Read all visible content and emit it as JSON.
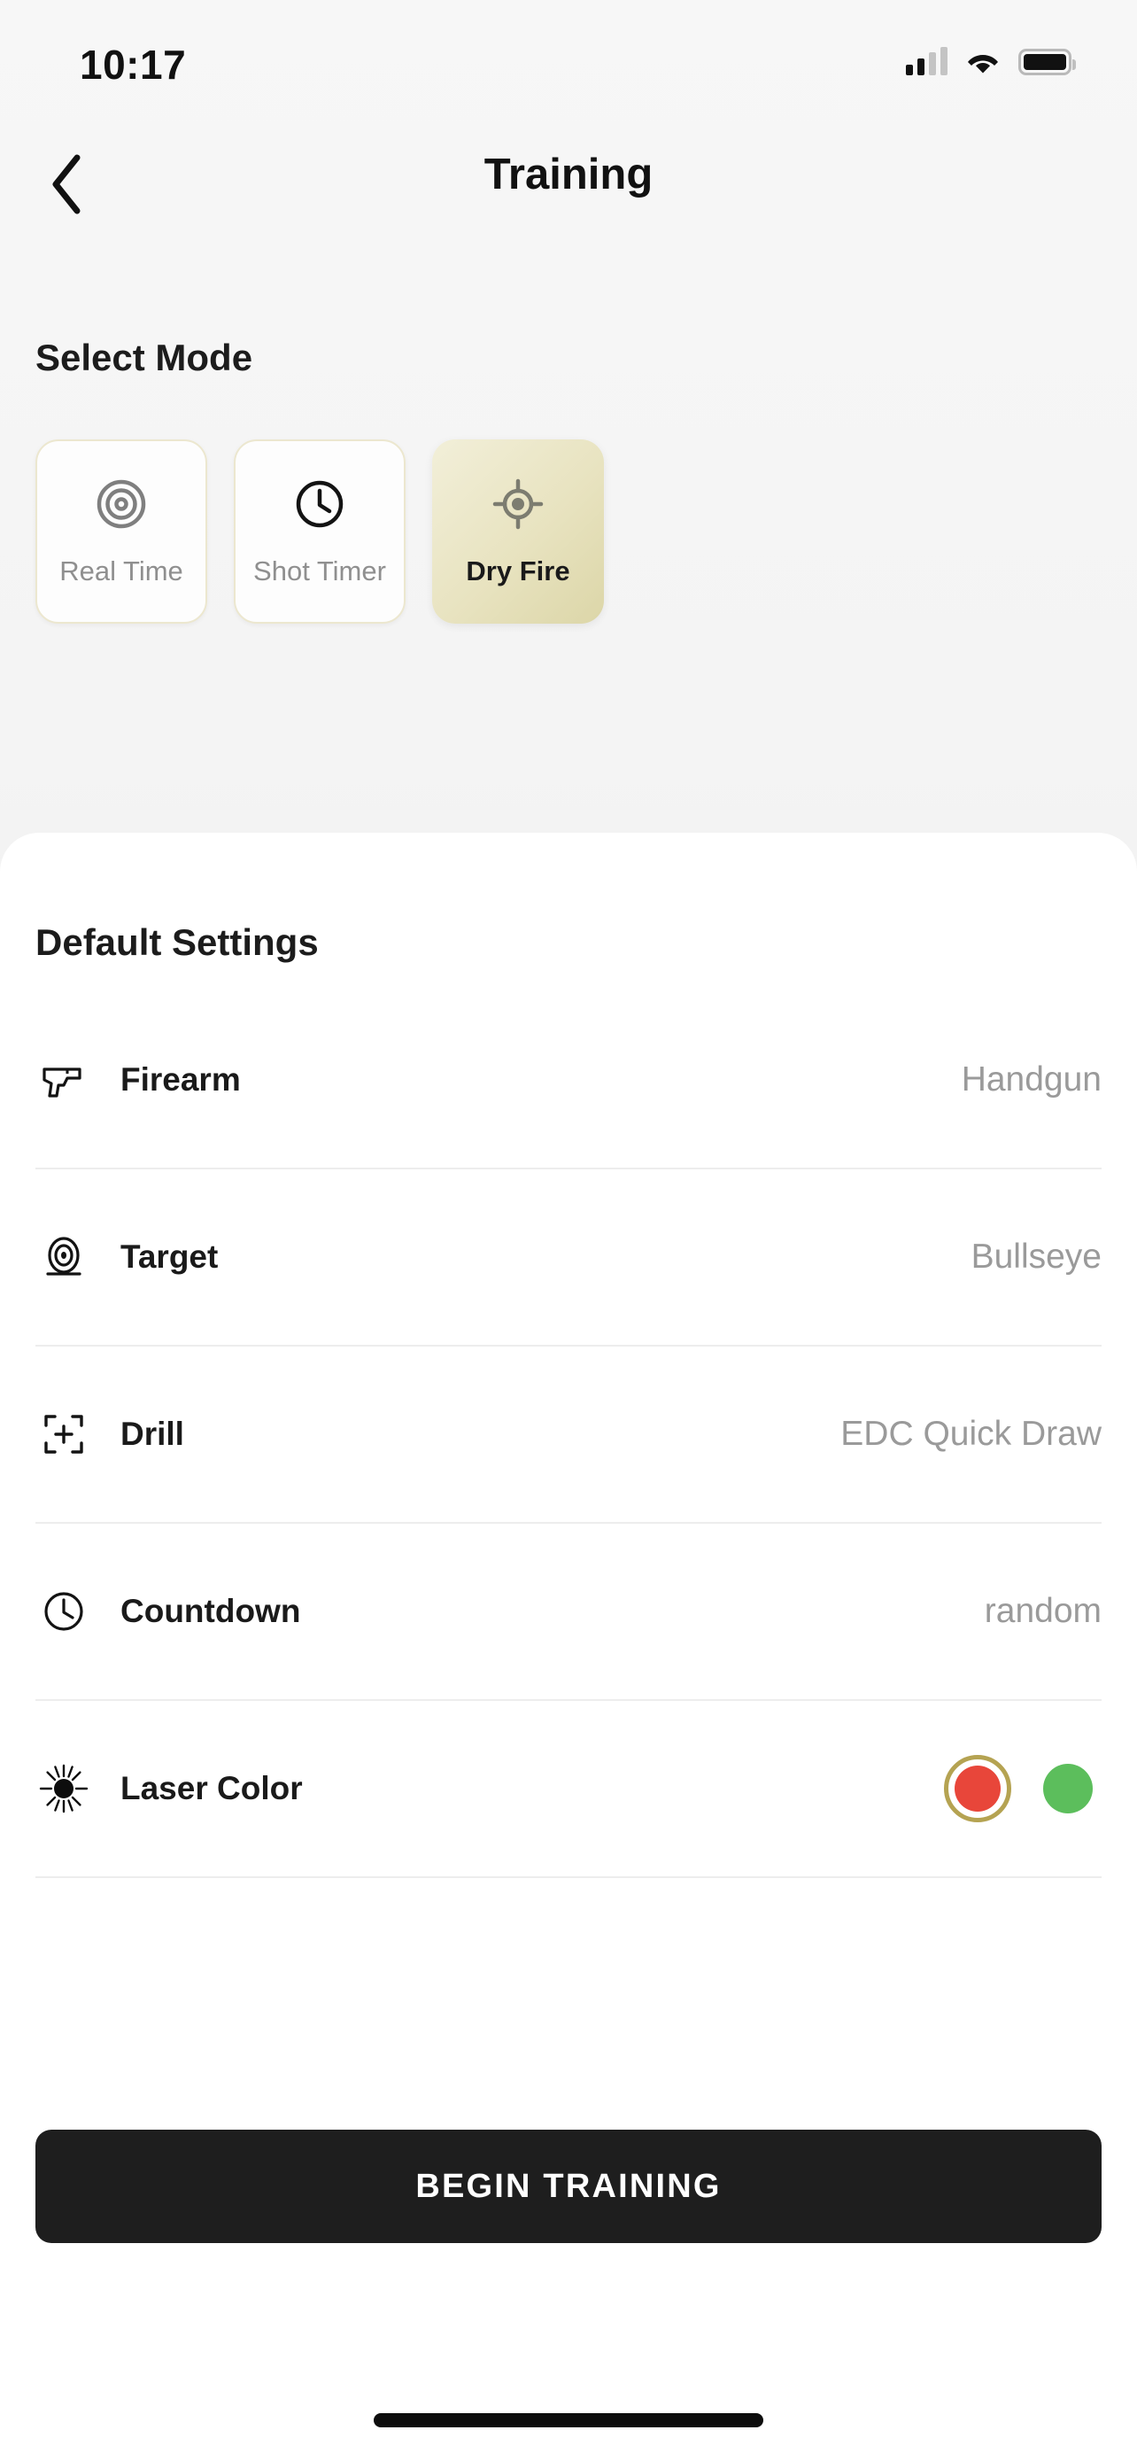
{
  "status_bar": {
    "time": "10:17",
    "cellular_icon": "signal-bars-icon",
    "wifi_icon": "wifi-icon",
    "battery_icon": "battery-full-icon"
  },
  "nav": {
    "back_icon": "chevron-left-icon",
    "title": "Training"
  },
  "select_mode": {
    "heading": "Select Mode",
    "modes": [
      {
        "label": "Real Time",
        "icon": "target-rings-icon",
        "selected": false
      },
      {
        "label": "Shot Timer",
        "icon": "clock-icon",
        "selected": false
      },
      {
        "label": "Dry Fire",
        "icon": "crosshair-icon",
        "selected": true
      }
    ]
  },
  "default_settings": {
    "heading": "Default Settings",
    "rows": [
      {
        "label": "Firearm",
        "value": "Handgun",
        "icon": "pistol-icon"
      },
      {
        "label": "Target",
        "value": "Bullseye",
        "icon": "target-stand-icon"
      },
      {
        "label": "Drill",
        "value": "EDC Quick Draw",
        "icon": "focus-frame-plus-icon"
      },
      {
        "label": "Countdown",
        "value": "random",
        "icon": "clock-icon"
      }
    ],
    "laser_color": {
      "label": "Laser Color",
      "icon": "starburst-icon",
      "options": [
        {
          "name": "red",
          "hex": "#E8463A",
          "selected": true
        },
        {
          "name": "green",
          "hex": "#5CBE5C",
          "selected": false
        }
      ],
      "selection_ring_hex": "#B5A352"
    }
  },
  "cta": {
    "label": "BEGIN TRAINING"
  },
  "colors": {
    "accent_khaki": "#DCD6A8",
    "card_border": "#ECE7CF",
    "cta_background": "#1E1E1E",
    "value_text": "#9A9A9A",
    "page_background": "#F4F4F4"
  }
}
